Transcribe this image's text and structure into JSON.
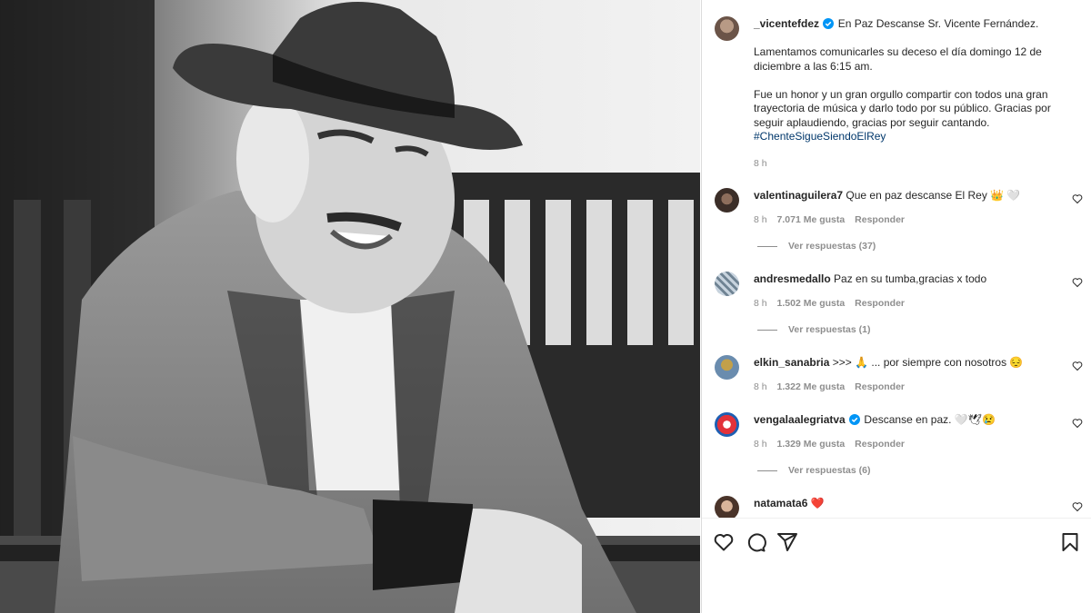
{
  "post": {
    "author": "_vicentefdez",
    "caption_title": "En Paz Descanse Sr. Vicente Fernández.",
    "caption_p1": "Lamentamos comunicarles su deceso el día domingo 12 de diciembre a las 6:15 am.",
    "caption_p2": "Fue un honor y un gran orgullo compartir con todos una gran trayectoria de música y darlo todo por su público. Gracias por seguir aplaudiendo, gracias por seguir cantando.",
    "hashtag": "#ChenteSigueSiendoElRey",
    "time": "8 h"
  },
  "comments": [
    {
      "user": "valentinaguilera7",
      "text": "Que en paz descanse El Rey 👑 🤍",
      "time": "8 h",
      "likes": "7.071 Me gusta",
      "reply": "Responder",
      "view_replies": "Ver respuestas (37)"
    },
    {
      "user": "andresmedallo",
      "text": "Paz en su tumba,gracias x todo",
      "time": "8 h",
      "likes": "1.502 Me gusta",
      "reply": "Responder",
      "view_replies": "Ver respuestas (1)"
    },
    {
      "user": "elkin_sanabria",
      "text": ">>> 🙏 ... por siempre con nosotros 😔",
      "time": "8 h",
      "likes": "1.322 Me gusta",
      "reply": "Responder"
    },
    {
      "user": "vengalaalegriatva",
      "text": "Descanse en paz. 🤍🕊😢",
      "time": "8 h",
      "likes": "1.329 Me gusta",
      "reply": "Responder",
      "view_replies": "Ver respuestas (6)"
    },
    {
      "user": "natamata6",
      "text": "❤️"
    }
  ],
  "icons": [
    "like-icon",
    "comment-icon",
    "share-icon",
    "save-icon"
  ],
  "colors": {
    "link": "#00376b",
    "verified": "#0095f6",
    "muted": "#8e8e8e",
    "text": "#262626"
  }
}
